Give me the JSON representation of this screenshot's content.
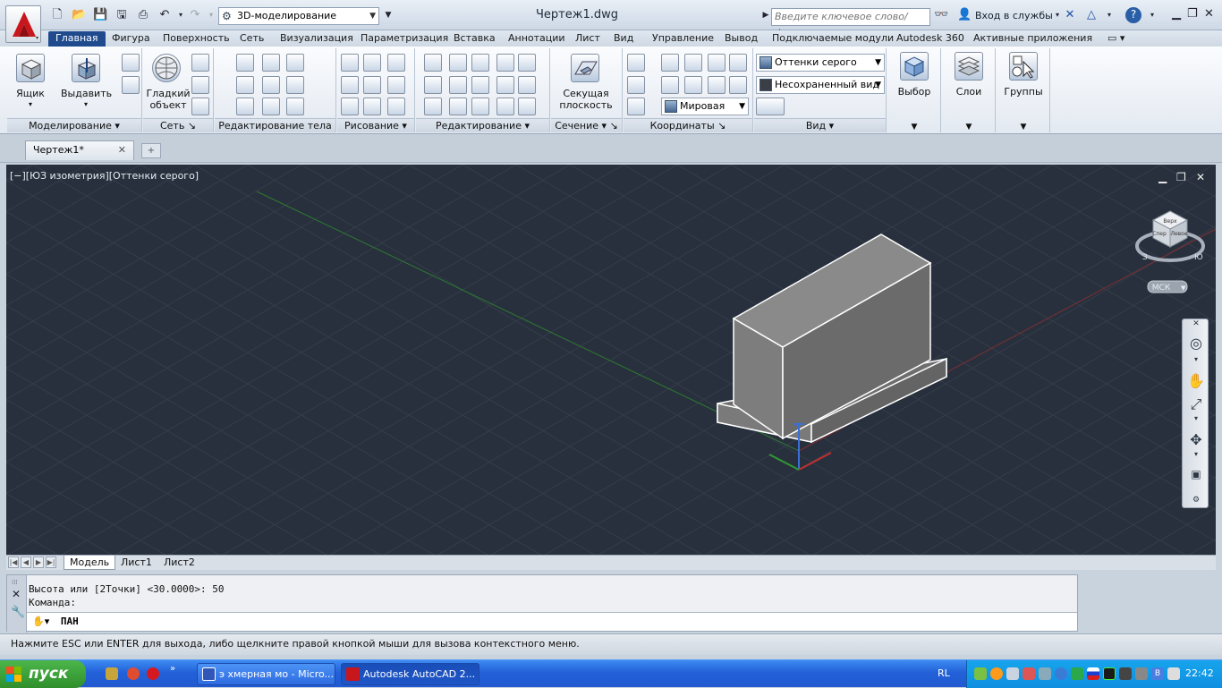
{
  "title_bar": {
    "workspace": "3D-моделирование",
    "document_title": "Чертеж1.dwg",
    "search_placeholder": "Введите ключевое слово/фразу",
    "signin": "Вход в службы"
  },
  "ribbon_tabs": [
    "Главная",
    "Фигура",
    "Поверхность",
    "Сеть",
    "Визуализация",
    "Параметризация",
    "Вставка",
    "Аннотации",
    "Лист",
    "Вид",
    "Управление",
    "Вывод",
    "Подключаемые модули",
    "Autodesk 360",
    "Активные приложения"
  ],
  "ribbon": {
    "box_label": "Ящик",
    "extrude_label": "Выдавить",
    "smooth_label_1": "Гладкий",
    "smooth_label_2": "объект",
    "section_label_1": "Секущая",
    "section_label_2": "плоскость",
    "visual_style": "Оттенки серого",
    "view_combo": "Несохраненный вид",
    "ucs_combo": "Мировая",
    "select_label": "Выбор",
    "layers_label": "Слои",
    "groups_label": "Группы",
    "panels": [
      "Моделирование",
      "Сеть",
      "Редактирование тела",
      "Рисование",
      "Редактирование",
      "Сечение",
      "Координаты",
      "Вид"
    ]
  },
  "doc_tabs": {
    "active": "Чертеж1*"
  },
  "viewport": {
    "label": "[−][ЮЗ изометрия][Оттенки серого]",
    "viewcube": {
      "top": "Верх",
      "front": "Спер",
      "right": "Левое",
      "compass_w": "З",
      "compass_s": "Ю",
      "wcs": "МСК"
    }
  },
  "layout_tabs": [
    "Модель",
    "Лист1",
    "Лист2"
  ],
  "command": {
    "history": [
      "Высота или [2Точки] <30.0000>: 50",
      "Команда:"
    ],
    "current": "ПАН"
  },
  "status_text": "Нажмите ESC или ENTER для выхода, либо щелкните правой кнопкой мыши для вызова контекстного меню.",
  "taskbar": {
    "start": "пуск",
    "items": [
      "э хмерная мо - Micro...",
      "Autodesk AutoCAD 2..."
    ],
    "lang": "RL",
    "clock": "22:42"
  },
  "colors": {
    "viewport_bg": "#28303d",
    "ribbon_tab_active": "#1f4b8e",
    "taskbar": "#2361d8",
    "start": "#3b9c37"
  }
}
